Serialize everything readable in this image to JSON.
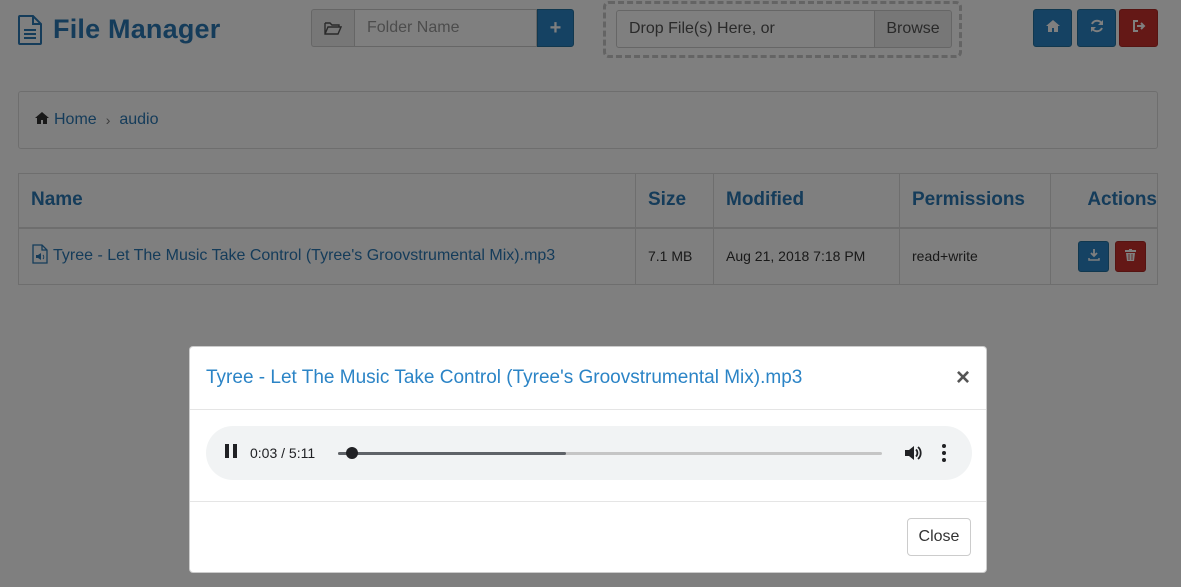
{
  "app": {
    "title": "File Manager"
  },
  "header": {
    "folder_placeholder": "Folder Name",
    "add_label": "+",
    "drop_text": "Drop File(s) Here, or",
    "browse_label": "Browse"
  },
  "breadcrumb": {
    "home": "Home",
    "separator": "›",
    "current": "audio"
  },
  "table": {
    "columns": [
      "Name",
      "Size",
      "Modified",
      "Permissions",
      "Actions"
    ],
    "rows": [
      {
        "name": "Tyree - Let The Music Take Control (Tyree's Groovstrumental Mix).mp3",
        "size": "7.1 MB",
        "modified": "Aug 21, 2018 7:18 PM",
        "permissions": "read+write"
      }
    ]
  },
  "modal": {
    "title": "Tyree - Let The Music Take Control (Tyree's Groovstrumental Mix).mp3",
    "close_x": "×",
    "player": {
      "time": "0:03 / 5:11",
      "played_fraction": 0.019,
      "buffered_fraction": 0.42
    },
    "close_label": "Close"
  },
  "colors": {
    "primary": "#2b84c6",
    "danger": "#c9302c",
    "link": "#2b78b5"
  },
  "icons": {
    "logo": "file-text-icon",
    "folder": "folder-open-icon",
    "home": "home-icon",
    "refresh": "refresh-icon",
    "logout": "sign-out-icon",
    "download": "download-icon",
    "trash": "trash-icon",
    "audio_file": "file-audio-icon",
    "pause": "pause-icon",
    "volume": "volume-icon",
    "more": "more-vert-icon"
  }
}
